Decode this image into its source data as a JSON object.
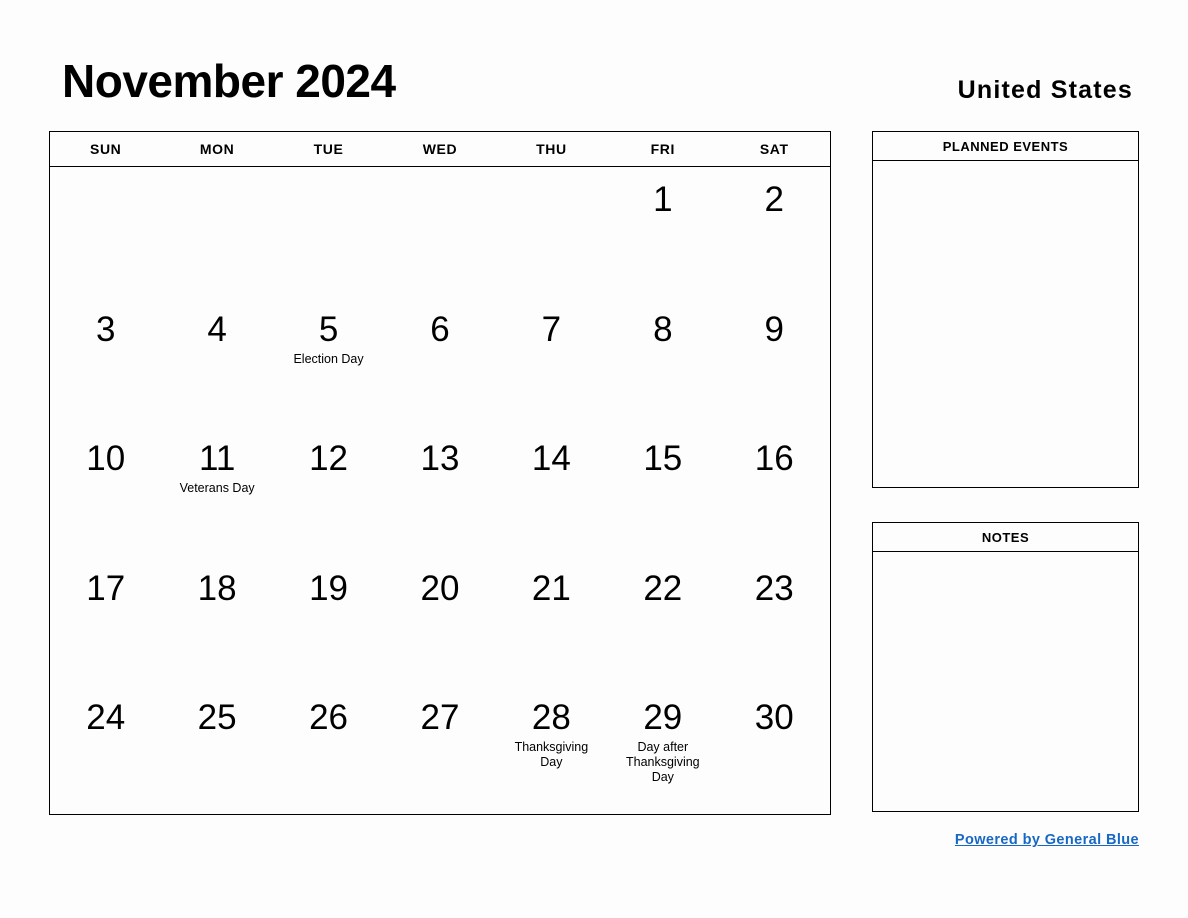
{
  "header": {
    "month_title": "November 2024",
    "country": "United States"
  },
  "calendar": {
    "weekdays": [
      "SUN",
      "MON",
      "TUE",
      "WED",
      "THU",
      "FRI",
      "SAT"
    ],
    "weeks": [
      [
        {
          "day": "",
          "event": ""
        },
        {
          "day": "",
          "event": ""
        },
        {
          "day": "",
          "event": ""
        },
        {
          "day": "",
          "event": ""
        },
        {
          "day": "",
          "event": ""
        },
        {
          "day": "1",
          "event": ""
        },
        {
          "day": "2",
          "event": ""
        }
      ],
      [
        {
          "day": "3",
          "event": ""
        },
        {
          "day": "4",
          "event": ""
        },
        {
          "day": "5",
          "event": "Election Day"
        },
        {
          "day": "6",
          "event": ""
        },
        {
          "day": "7",
          "event": ""
        },
        {
          "day": "8",
          "event": ""
        },
        {
          "day": "9",
          "event": ""
        }
      ],
      [
        {
          "day": "10",
          "event": ""
        },
        {
          "day": "11",
          "event": "Veterans Day"
        },
        {
          "day": "12",
          "event": ""
        },
        {
          "day": "13",
          "event": ""
        },
        {
          "day": "14",
          "event": ""
        },
        {
          "day": "15",
          "event": ""
        },
        {
          "day": "16",
          "event": ""
        }
      ],
      [
        {
          "day": "17",
          "event": ""
        },
        {
          "day": "18",
          "event": ""
        },
        {
          "day": "19",
          "event": ""
        },
        {
          "day": "20",
          "event": ""
        },
        {
          "day": "21",
          "event": ""
        },
        {
          "day": "22",
          "event": ""
        },
        {
          "day": "23",
          "event": ""
        }
      ],
      [
        {
          "day": "24",
          "event": ""
        },
        {
          "day": "25",
          "event": ""
        },
        {
          "day": "26",
          "event": ""
        },
        {
          "day": "27",
          "event": ""
        },
        {
          "day": "28",
          "event": "Thanksgiving Day"
        },
        {
          "day": "29",
          "event": "Day after Thanksgiving Day"
        },
        {
          "day": "30",
          "event": ""
        }
      ]
    ]
  },
  "panels": {
    "events": {
      "title": "PLANNED EVENTS",
      "content": ""
    },
    "notes": {
      "title": "NOTES",
      "content": ""
    }
  },
  "footer": {
    "link_label": "Powered by General Blue",
    "link_color": "#1668c4"
  }
}
